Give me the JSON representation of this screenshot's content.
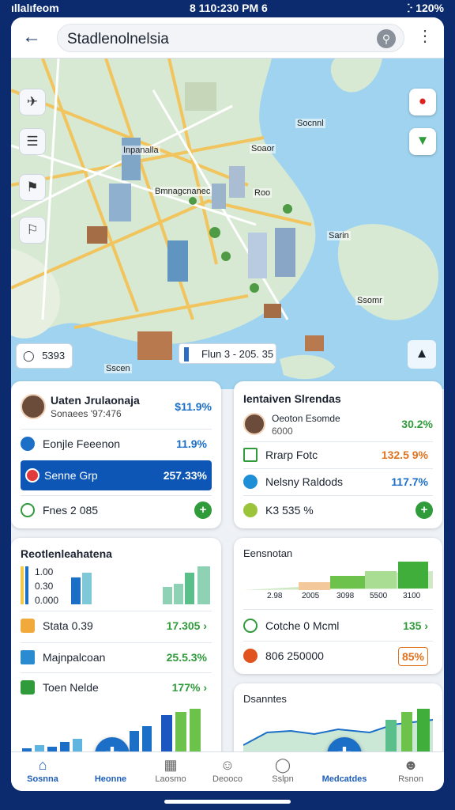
{
  "status": {
    "left": "ıllalıfeom",
    "time": "8 110:230 PM 6",
    "right": "ⴾ 120%"
  },
  "header": {
    "title": "Stadlenolnelsia",
    "back_icon": "arrow-left-icon",
    "search_icon": "search-icon",
    "more_icon": "more-vertical-icon"
  },
  "map": {
    "labels": [
      "Inpanalla",
      "Bmnagcnanec",
      "Roo",
      "Soaor",
      "Socnnl",
      "Sarin",
      "Ssomr",
      "Sscen"
    ],
    "zoom_label": "5393",
    "time_label": "Flun 3 - 205. 35"
  },
  "card1": {
    "name": "Uaten Jrulaonaja",
    "sub": "Sonaees '97:476",
    "main_value": "$11.9%",
    "rows": [
      {
        "label": "Eonjle Feeenon",
        "value": "11.9%"
      },
      {
        "label": "Senne Grp",
        "value": "257.33%"
      },
      {
        "label": "Fnes 2 085",
        "value": ""
      }
    ]
  },
  "card2": {
    "title": "Ientaiven Slrendas",
    "person_name": "Oeoton Esomde",
    "person_sub": "6000",
    "person_value": "30.2%",
    "rows": [
      {
        "label": "Rrarp Fotc",
        "value": "132.5 9%"
      },
      {
        "label": "Nelsny Raldods",
        "value": "117.7%"
      },
      {
        "label": "K3 535 %",
        "value": ""
      }
    ]
  },
  "card3": {
    "title": "Reotlenleahatena",
    "legend": [
      "1.00",
      "0.30",
      "0.000"
    ],
    "rows": [
      {
        "label": "Stata 0.39",
        "value": "17.305 ›"
      },
      {
        "label": "Majnpalcoan",
        "value": "25.5.3%"
      },
      {
        "label": "Toen Nelde",
        "value": "177% ›"
      }
    ]
  },
  "card4": {
    "title": "Eensnotan",
    "ticks": [
      "2.98",
      "2005",
      "3098",
      "5500",
      "3100"
    ],
    "rows": [
      {
        "label": "Cotche 0 Mcml",
        "value": "135 ›"
      },
      {
        "label": "806 250000",
        "value": "85%"
      }
    ]
  },
  "card5": {
    "title": "Dsanntes"
  },
  "nav": [
    {
      "label": "Sosnna",
      "icon": "home-icon"
    },
    {
      "label": "Heonne",
      "icon": "map-pin-icon"
    },
    {
      "label": "Laosmo",
      "icon": "chart-icon"
    },
    {
      "label": "Deooco",
      "icon": "profile-icon"
    },
    {
      "label": "Sslpn",
      "icon": "help-icon"
    },
    {
      "label": "Medcatdes",
      "icon": "location-icon"
    },
    {
      "label": "Rsnon",
      "icon": "user-icon"
    }
  ],
  "colors": {
    "accent": "#1c6fc7",
    "green": "#2f9b3a",
    "orange": "#e0731f",
    "navy": "#0b2b6e"
  }
}
